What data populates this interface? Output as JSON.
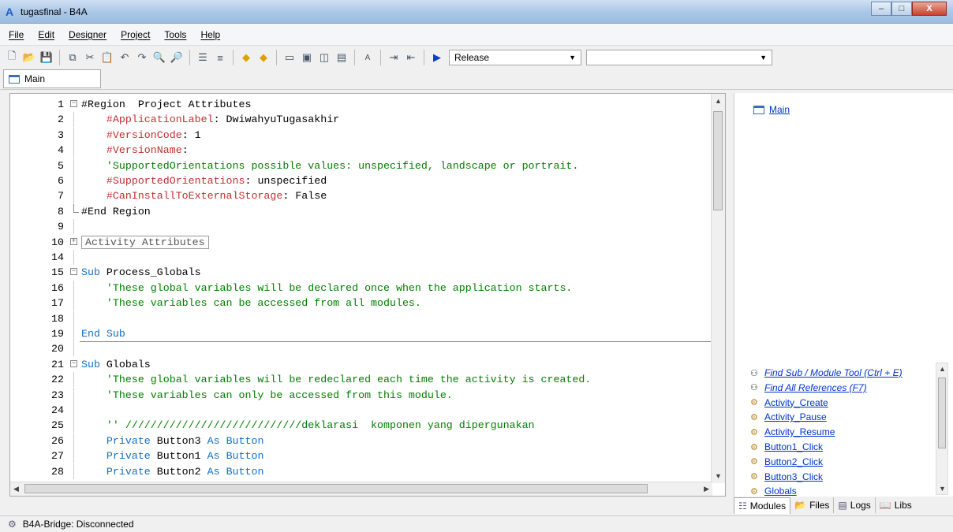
{
  "window": {
    "title": "tugasfinal - B4A",
    "app_icon": "A",
    "minimize": "–",
    "maximize": "□",
    "close": "X"
  },
  "menu": [
    "File",
    "Edit",
    "Designer",
    "Project",
    "Tools",
    "Help"
  ],
  "toolbar": {
    "icons": [
      "new-file-icon",
      "open-folder-icon",
      "save-icon",
      "copy-icon",
      "cut-icon",
      "paste-icon",
      "undo-icon",
      "redo-icon",
      "find-icon",
      "find-replace-icon",
      "comment-icon",
      "uncomment-icon",
      "back-icon",
      "forward-icon",
      "form-icon",
      "designer-icon",
      "bridge-icon",
      "device-icon",
      "font-icon",
      "indent-icon",
      "outdent-icon",
      "run-icon"
    ],
    "build_config": "Release",
    "device_select": ""
  },
  "tabs": [
    {
      "label": "Main"
    }
  ],
  "code_lines": [
    {
      "n": "1",
      "fold": "minus",
      "parts": [
        [
          "plain",
          "#Region  Project Attributes"
        ]
      ]
    },
    {
      "n": "2",
      "parts": [
        [
          "plain",
          "    "
        ],
        [
          "dir",
          "#ApplicationLabel"
        ],
        [
          "plain",
          ": DwiwahyuTugasakhir"
        ]
      ]
    },
    {
      "n": "3",
      "parts": [
        [
          "plain",
          "    "
        ],
        [
          "dir",
          "#VersionCode"
        ],
        [
          "plain",
          ": 1"
        ]
      ]
    },
    {
      "n": "4",
      "parts": [
        [
          "plain",
          "    "
        ],
        [
          "dir",
          "#VersionName"
        ],
        [
          "plain",
          ":"
        ]
      ]
    },
    {
      "n": "5",
      "parts": [
        [
          "plain",
          "    "
        ],
        [
          "com",
          "'SupportedOrientations possible values: unspecified, landscape or portrait."
        ]
      ]
    },
    {
      "n": "6",
      "parts": [
        [
          "plain",
          "    "
        ],
        [
          "dir",
          "#SupportedOrientations"
        ],
        [
          "plain",
          ": unspecified"
        ]
      ]
    },
    {
      "n": "7",
      "parts": [
        [
          "plain",
          "    "
        ],
        [
          "dir",
          "#CanInstallToExternalStorage"
        ],
        [
          "plain",
          ": False"
        ]
      ]
    },
    {
      "n": "8",
      "fold": "end",
      "parts": [
        [
          "plain",
          "#End Region"
        ]
      ]
    },
    {
      "n": "9",
      "parts": []
    },
    {
      "n": "10",
      "fold": "plus",
      "parts": [
        [
          "box",
          "Activity Attributes"
        ]
      ]
    },
    {
      "n": "14",
      "parts": []
    },
    {
      "n": "15",
      "fold": "minus",
      "parts": [
        [
          "kw",
          "Sub"
        ],
        [
          "plain",
          " Process_Globals"
        ]
      ]
    },
    {
      "n": "16",
      "parts": [
        [
          "plain",
          "    "
        ],
        [
          "com",
          "'These global variables will be declared once when the application starts."
        ]
      ]
    },
    {
      "n": "17",
      "parts": [
        [
          "plain",
          "    "
        ],
        [
          "com",
          "'These variables can be accessed from all modules."
        ]
      ]
    },
    {
      "n": "18",
      "parts": []
    },
    {
      "n": "19",
      "parts": [
        [
          "kw",
          "End Sub"
        ]
      ]
    },
    {
      "n": "20",
      "parts": []
    },
    {
      "n": "21",
      "fold": "minus",
      "parts": [
        [
          "kw",
          "Sub"
        ],
        [
          "plain",
          " Globals"
        ]
      ]
    },
    {
      "n": "22",
      "parts": [
        [
          "plain",
          "    "
        ],
        [
          "com",
          "'These global variables will be redeclared each time the activity is created."
        ]
      ]
    },
    {
      "n": "23",
      "parts": [
        [
          "plain",
          "    "
        ],
        [
          "com",
          "'These variables can only be accessed from this module."
        ]
      ]
    },
    {
      "n": "24",
      "parts": []
    },
    {
      "n": "25",
      "parts": [
        [
          "plain",
          "    "
        ],
        [
          "com",
          "'' ////////////////////////////deklarasi  komponen yang dipergunakan"
        ]
      ]
    },
    {
      "n": "26",
      "parts": [
        [
          "plain",
          "    "
        ],
        [
          "kw",
          "Private"
        ],
        [
          "plain",
          " Button3 "
        ],
        [
          "kw",
          "As"
        ],
        [
          "plain",
          " "
        ],
        [
          "kw",
          "Button"
        ]
      ]
    },
    {
      "n": "27",
      "parts": [
        [
          "plain",
          "    "
        ],
        [
          "kw",
          "Private"
        ],
        [
          "plain",
          " Button1 "
        ],
        [
          "kw",
          "As"
        ],
        [
          "plain",
          " "
        ],
        [
          "kw",
          "Button"
        ]
      ]
    },
    {
      "n": "28",
      "parts": [
        [
          "plain",
          "    "
        ],
        [
          "kw",
          "Private"
        ],
        [
          "plain",
          " Button2 "
        ],
        [
          "kw",
          "As"
        ],
        [
          "plain",
          " "
        ],
        [
          "kw",
          "Button"
        ]
      ]
    }
  ],
  "modules_panel": {
    "items": [
      "Main"
    ]
  },
  "references": [
    {
      "label": "Find Sub / Module Tool (Ctrl + E)",
      "italic": true,
      "icon": "binoculars-icon"
    },
    {
      "label": "Find All References (F7)",
      "italic": true,
      "icon": "binoculars-icon"
    },
    {
      "label": "Activity_Create",
      "italic": false,
      "icon": "sub-icon"
    },
    {
      "label": "Activity_Pause",
      "italic": false,
      "icon": "sub-icon"
    },
    {
      "label": "Activity_Resume",
      "italic": false,
      "icon": "sub-icon"
    },
    {
      "label": "Button1_Click",
      "italic": false,
      "icon": "sub-icon"
    },
    {
      "label": "Button2_Click",
      "italic": false,
      "icon": "sub-icon"
    },
    {
      "label": "Button3_Click",
      "italic": false,
      "icon": "sub-icon"
    },
    {
      "label": "Globals",
      "italic": false,
      "icon": "sub-icon"
    }
  ],
  "bottom_tabs": [
    {
      "label": "Modules",
      "icon": "modules-icon"
    },
    {
      "label": "Files",
      "icon": "folder-icon"
    },
    {
      "label": "Logs",
      "icon": "logs-icon"
    },
    {
      "label": "Libs",
      "icon": "book-icon"
    }
  ],
  "status": {
    "text": "B4A-Bridge: Disconnected"
  },
  "colors": {
    "keyword": "#1070c8",
    "directive": "#c03030",
    "comment": "#008000",
    "link": "#0033cc"
  }
}
